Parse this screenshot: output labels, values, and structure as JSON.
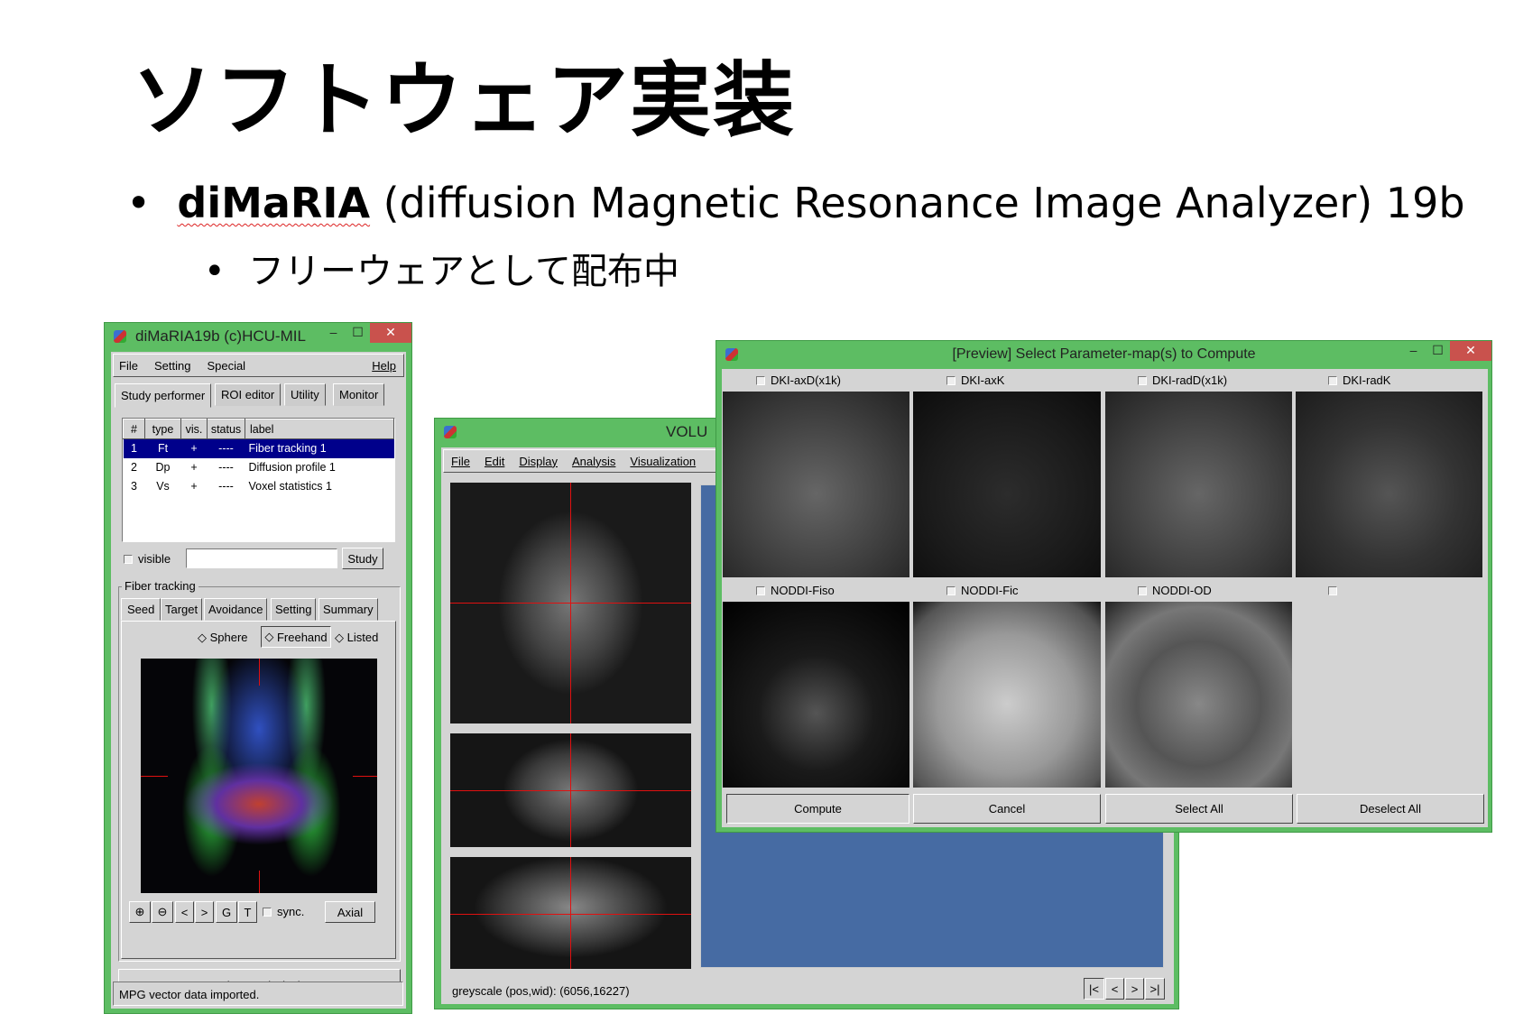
{
  "slide": {
    "title": "ソフトウェア実装",
    "bullet1_name": "diMaRIA",
    "bullet1_rest": " (diffusion Magnetic Resonance Image Analyzer) 19b",
    "bullet2": "フリーウェアとして配布中"
  },
  "main_window": {
    "title": "diMaRIA19b (c)HCU-MIL",
    "menu": [
      "File",
      "Setting",
      "Special"
    ],
    "help": "Help",
    "tabs": [
      "Study performer",
      "ROI editor",
      "Utility",
      "Monitor"
    ],
    "table": {
      "headers": [
        "#",
        "type",
        "vis.",
        "status",
        "label"
      ],
      "rows": [
        [
          "1",
          "Ft",
          "+",
          "----",
          "Fiber tracking 1"
        ],
        [
          "2",
          "Dp",
          "+",
          "----",
          "Diffusion profile 1"
        ],
        [
          "3",
          "Vs",
          "+",
          "----",
          "Voxel statistics 1"
        ]
      ],
      "selected_row": 0
    },
    "visible_label": "visible",
    "name_input": "",
    "study_button": "Study",
    "group_label": "Fiber tracking",
    "subtabs": [
      "Seed",
      "Target",
      "Avoidance",
      "Setting",
      "Summary"
    ],
    "seed_modes": [
      "Sphere",
      "Freehand",
      "Listed"
    ],
    "seed_mode_selected": "Freehand",
    "toolbar": {
      "prev": "<",
      "next": ">",
      "g": "G",
      "t": "T",
      "sync": "sync.",
      "axial": "Axial"
    },
    "analyze_button": "Analyze and Display",
    "status": "MPG vector data imported."
  },
  "volume_window": {
    "title": "VOLU",
    "menu": [
      "File",
      "Edit",
      "Display",
      "Analysis",
      "Visualization"
    ],
    "status": "greyscale (pos,wid): (6056,16227)",
    "nav": [
      "|<",
      "<",
      ">",
      ">|"
    ]
  },
  "preview_window": {
    "title": "[Preview] Select Parameter-map(s) to Compute",
    "maps": [
      {
        "label": "DKI-axD(x1k)",
        "checked": false
      },
      {
        "label": "DKI-axK",
        "checked": false
      },
      {
        "label": "DKI-radD(x1k)",
        "checked": false
      },
      {
        "label": "DKI-radK",
        "checked": false
      },
      {
        "label": "NODDI-Fiso",
        "checked": false
      },
      {
        "label": "NODDI-Fic",
        "checked": false
      },
      {
        "label": "NODDI-OD",
        "checked": false
      },
      {
        "label": "",
        "checked": false
      }
    ],
    "buttons": [
      "Compute",
      "Cancel",
      "Select All",
      "Deselect All"
    ]
  },
  "colors": {
    "window_frame": "#5dbd63",
    "close_button": "#c9524d",
    "selection": "#00008b",
    "volume_bg": "#466ba3",
    "crosshair": "#e01010"
  }
}
